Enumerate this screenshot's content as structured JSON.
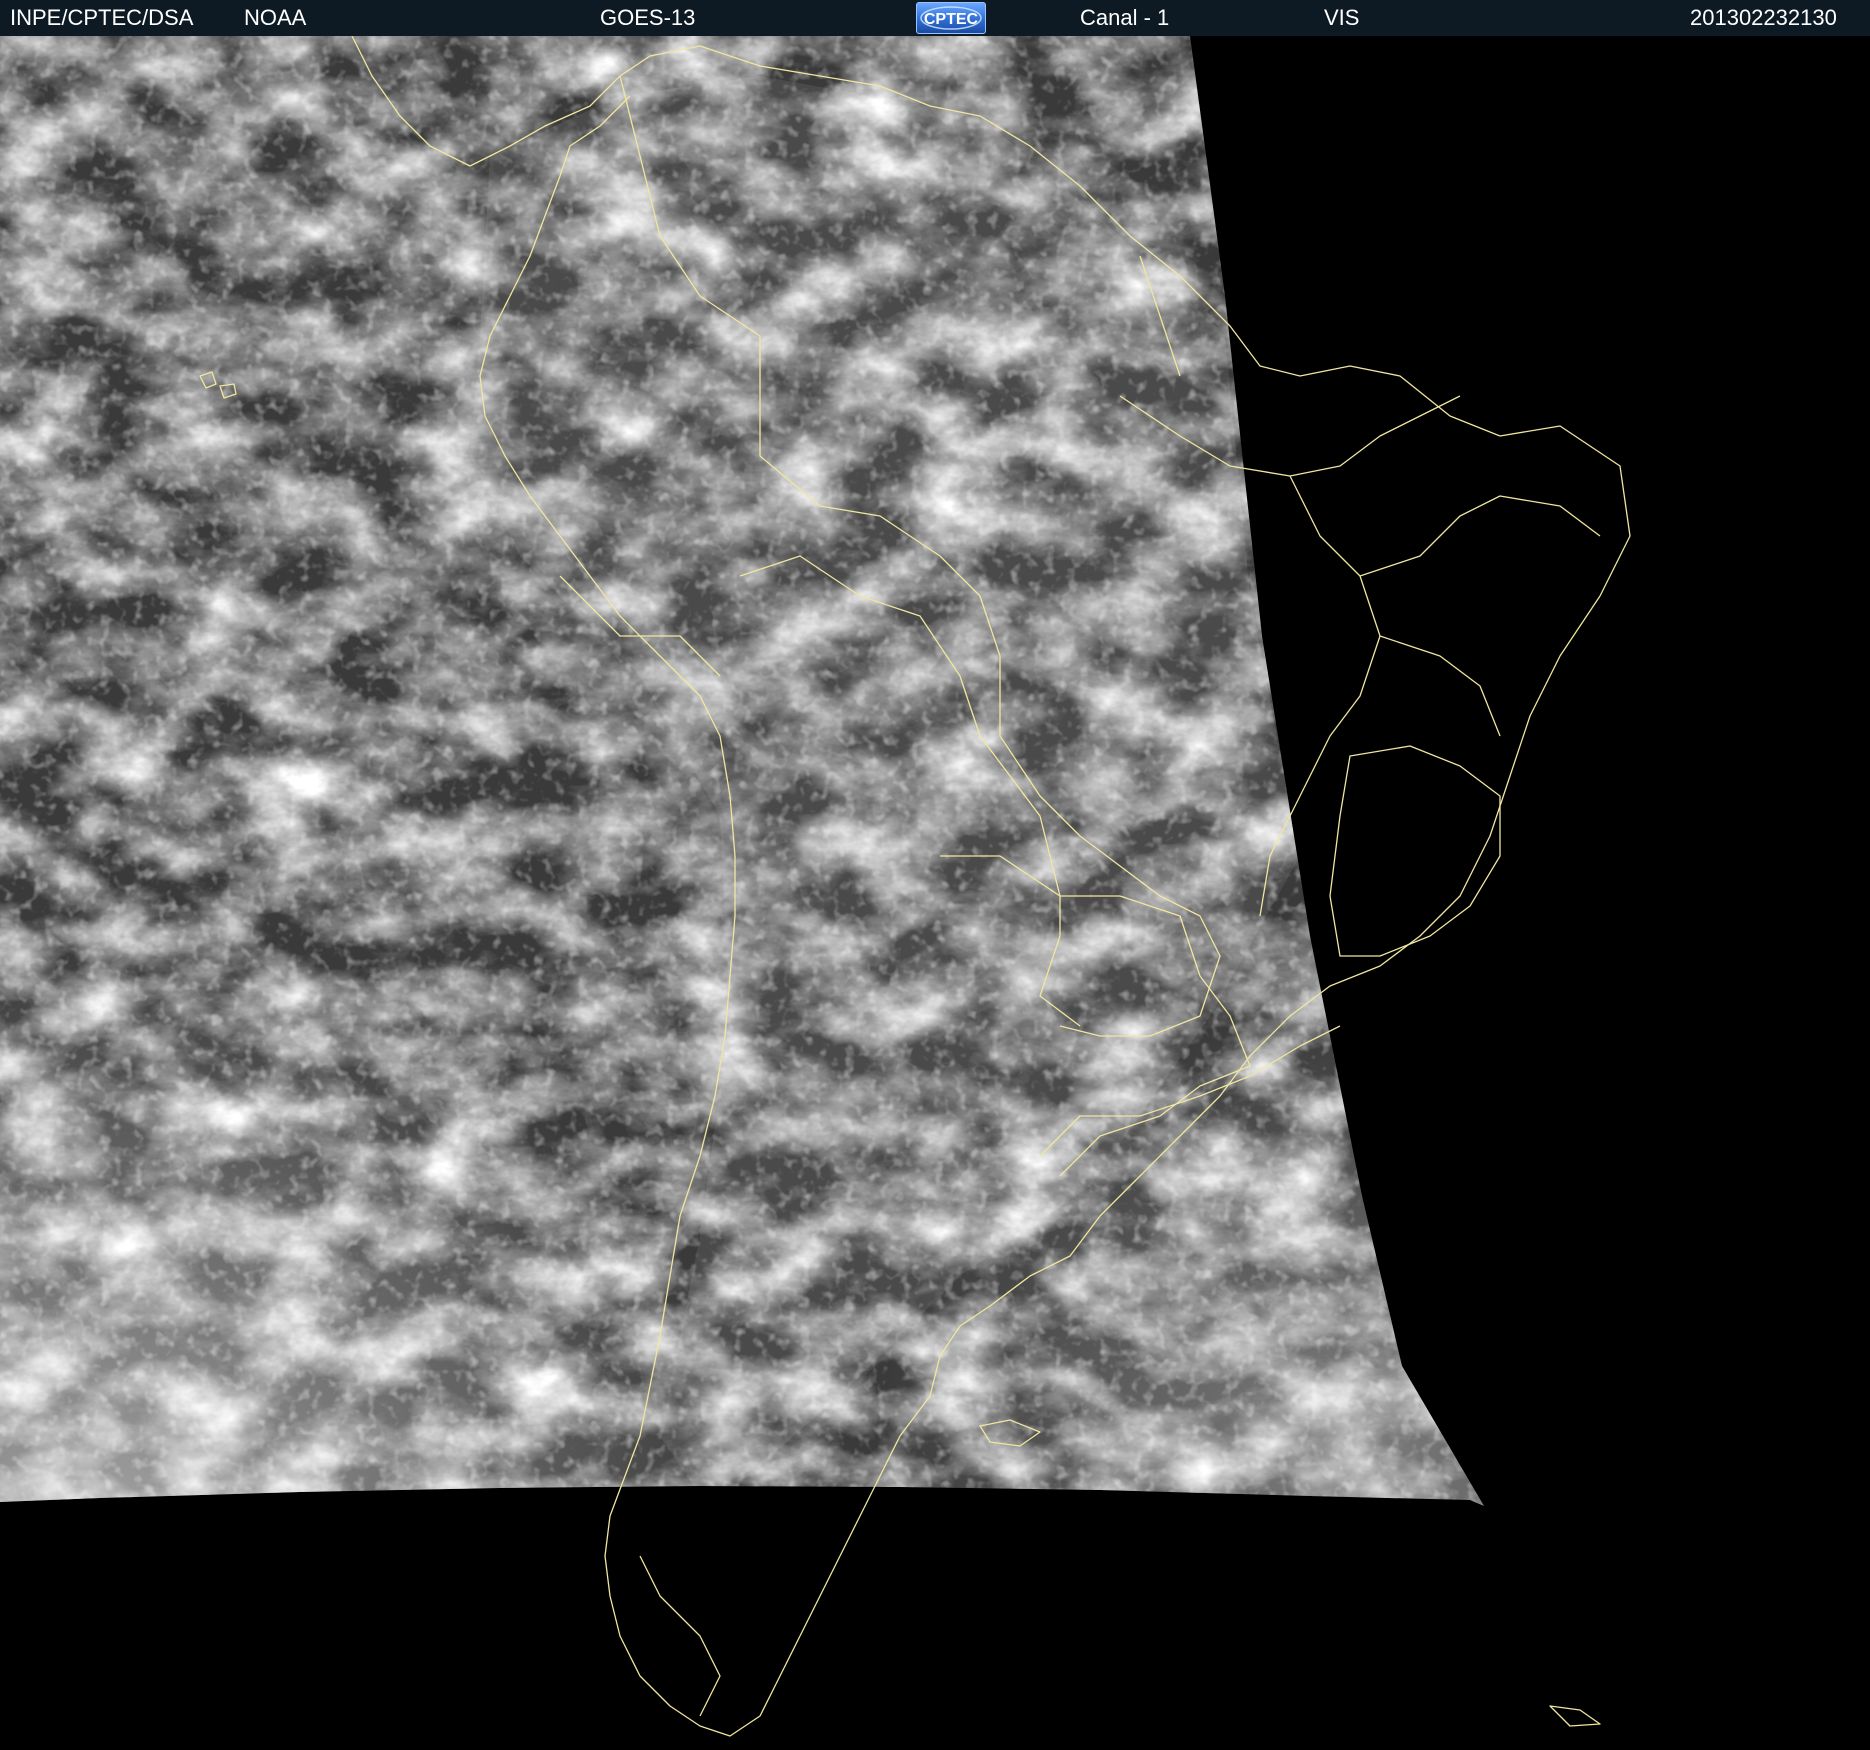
{
  "header": {
    "agency": "INPE/CPTEC/DSA",
    "source": "NOAA",
    "satellite": "GOES-13",
    "logo_text": "CPTEC",
    "channel": "Canal - 1",
    "band": "VIS",
    "timestamp": "201302232130"
  },
  "colors": {
    "header_background": "#0d1a24",
    "header_text": "#ffffff",
    "background": "#000000",
    "border_lines": "#f0e6a0",
    "logo_blue": "#2f6fd6"
  },
  "icons": {
    "logo": "cptec-logo-icon"
  }
}
